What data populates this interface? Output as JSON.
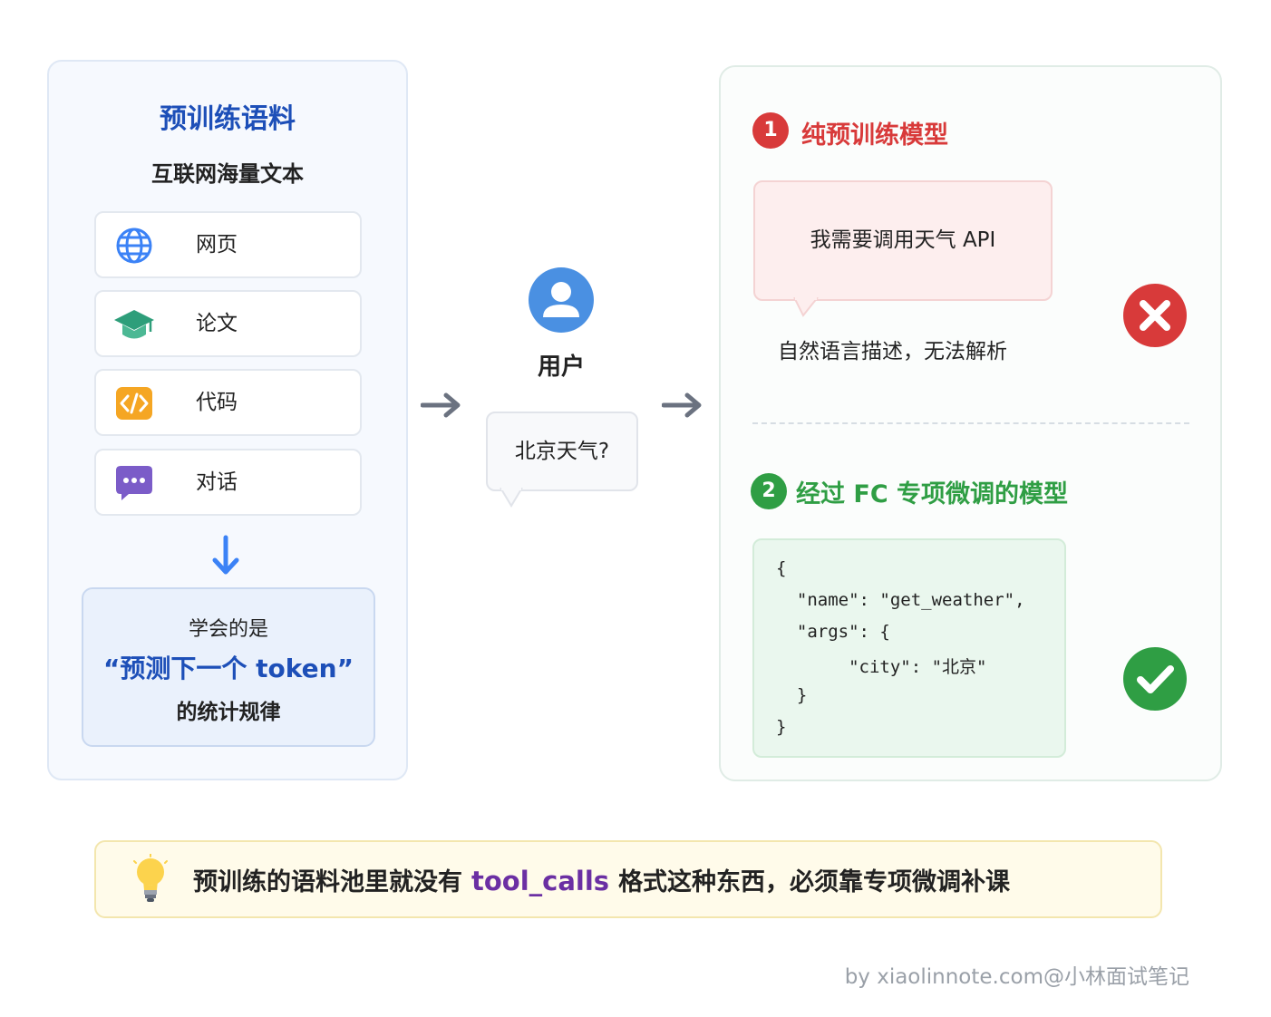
{
  "left_panel": {
    "title": "预训练语料",
    "subtitle": "互联网海量文本",
    "sources": [
      {
        "label": "网页",
        "icon": "globe-icon"
      },
      {
        "label": "论文",
        "icon": "graduation-cap-icon"
      },
      {
        "label": "代码",
        "icon": "code-icon"
      },
      {
        "label": "对话",
        "icon": "chat-bubble-icon"
      }
    ],
    "learned": {
      "line1": "学会的是",
      "line2": "“预测下一个 token”",
      "line3": "的统计规律"
    }
  },
  "user": {
    "label": "用户",
    "question": "北京天气?"
  },
  "right_panel": {
    "section1": {
      "number": "1",
      "title": "纯预训练模型",
      "bubble_text": "我需要调用天气 API",
      "caption": "自然语言描述，无法解析",
      "status_icon": "x-icon"
    },
    "section2": {
      "number": "2",
      "title": "经过 FC 专项微调的模型",
      "code_lines": [
        "{",
        "  \"name\": \"get_weather\",",
        "  \"args\": {",
        "       \"city\": \"北京\"",
        "  }",
        "}"
      ],
      "status_icon": "check-icon"
    }
  },
  "tip": {
    "before": "预训练的语料池里就没有",
    "code": "tool_calls",
    "after": "格式这种东西，必须靠专项微调补课"
  },
  "footer": "by xiaolinnote.com@小林面试笔记",
  "colors": {
    "blue_title": "#1d4fb8",
    "red_accent": "#d83a3a",
    "green_accent": "#2f9e44",
    "purple_code": "#6b2fa3"
  }
}
